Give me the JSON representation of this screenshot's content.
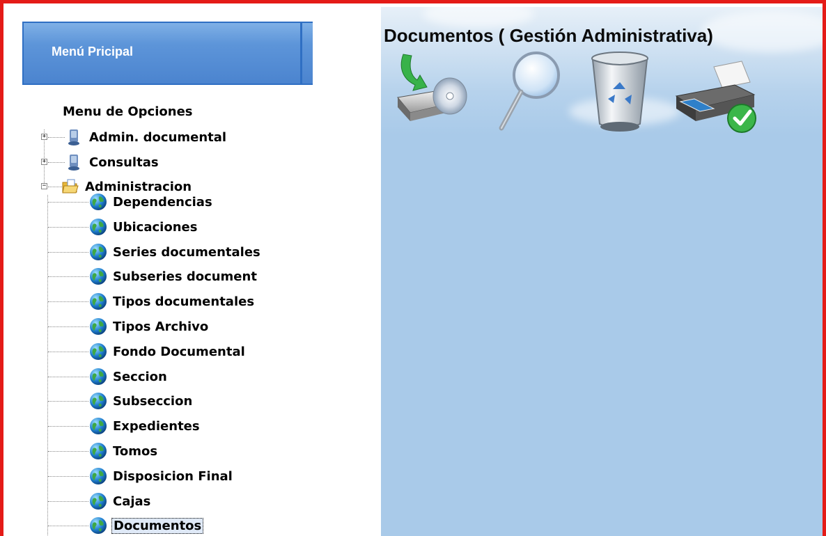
{
  "header": {
    "title": "Menú Pricipal"
  },
  "sidebar": {
    "caption": "Menu de Opciones",
    "top_items": [
      {
        "label": "Admin. documental",
        "expander": "+"
      },
      {
        "label": "Consultas",
        "expander": "+"
      },
      {
        "label": "Administracion",
        "expander": "−"
      }
    ],
    "children": [
      {
        "label": "Dependencias"
      },
      {
        "label": "Ubicaciones"
      },
      {
        "label": "Series documentales"
      },
      {
        "label": "Subseries document"
      },
      {
        "label": "Tipos documentales"
      },
      {
        "label": "Tipos Archivo"
      },
      {
        "label": "Fondo Documental"
      },
      {
        "label": "Seccion"
      },
      {
        "label": "Subseccion"
      },
      {
        "label": "Expedientes"
      },
      {
        "label": "Tomos"
      },
      {
        "label": "Disposicion Final"
      },
      {
        "label": "Cajas"
      },
      {
        "label": "Documentos"
      }
    ],
    "selected": "Documentos"
  },
  "main": {
    "title": "Documentos ( Gestión Administrativa)",
    "toolbar": [
      {
        "icon": "save-disk-icon"
      },
      {
        "icon": "search-magnifier-icon"
      },
      {
        "icon": "recycle-bin-icon"
      },
      {
        "icon": "printer-icon"
      }
    ]
  },
  "colors": {
    "frame_border": "#e41b17",
    "header_blue": "#5d95d9",
    "content_bg": "#a9cae9"
  }
}
